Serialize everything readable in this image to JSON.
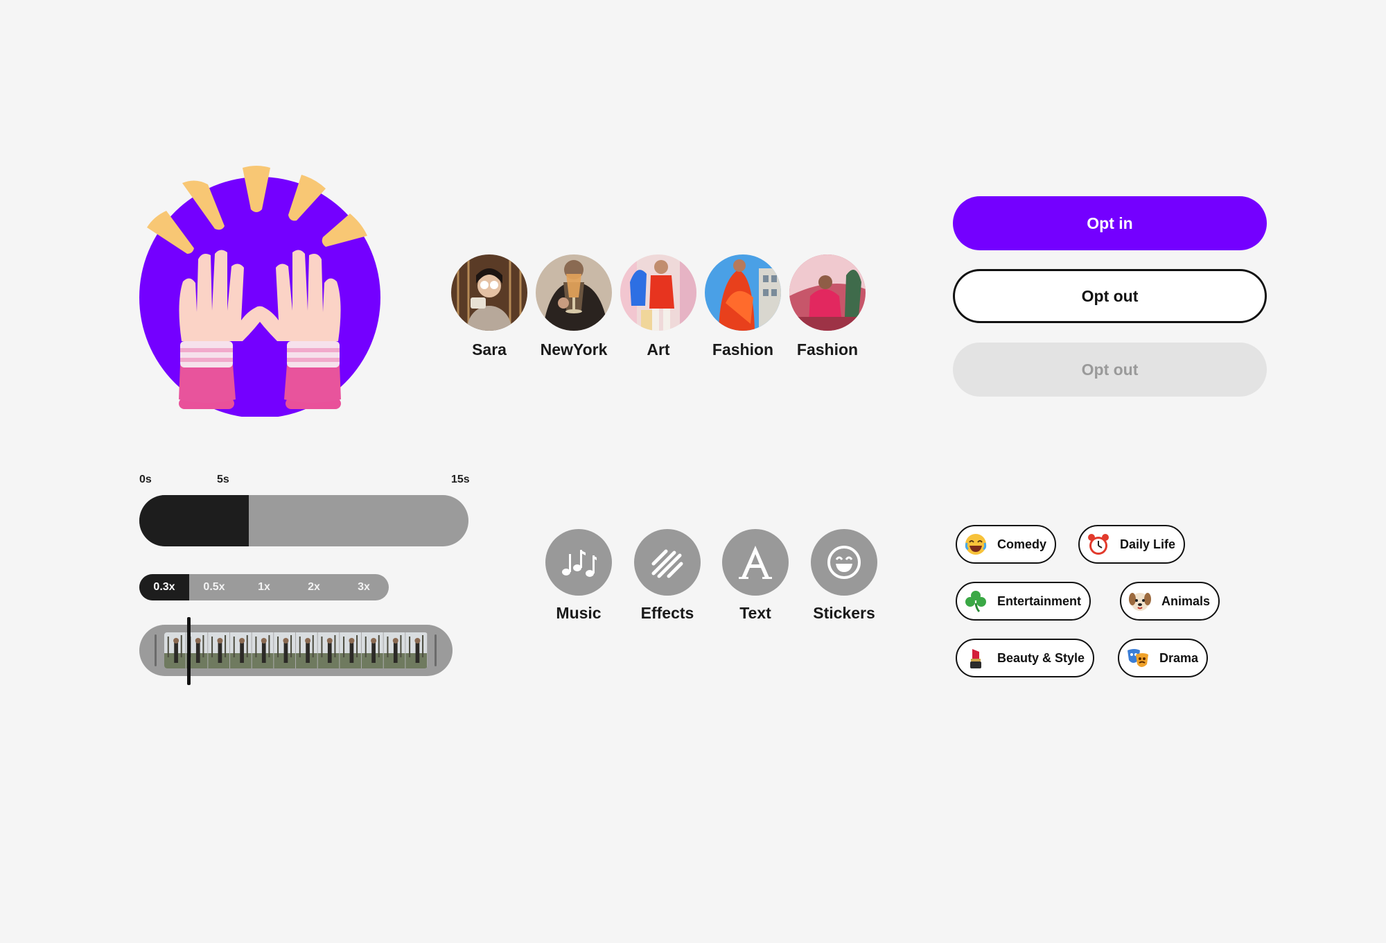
{
  "colors": {
    "accent": "#7400ff",
    "background": "#f5f5f5",
    "dark": "#1d1d1d",
    "muted": "#9b9b9b",
    "disabled": "#e3e3e3"
  },
  "hero": {
    "icon": "raised-hands-icon"
  },
  "stories": [
    {
      "label": "Sara"
    },
    {
      "label": "NewYork"
    },
    {
      "label": "Art"
    },
    {
      "label": "Fashion"
    },
    {
      "label": "Fashion"
    }
  ],
  "buttons": {
    "opt_in": "Opt in",
    "opt_out": "Opt out",
    "opt_out_disabled": "Opt out"
  },
  "timeline": {
    "ticks": [
      "0s",
      "5s",
      "15s"
    ],
    "current_seconds": 5,
    "max_seconds": 15
  },
  "speed": {
    "options": [
      "0.3x",
      "0.5x",
      "1x",
      "2x",
      "3x"
    ],
    "selected": "0.3x"
  },
  "filmstrip": {
    "frame_count": 12
  },
  "tools": [
    {
      "label": "Music",
      "icon": "music-notes-icon"
    },
    {
      "label": "Effects",
      "icon": "effects-stripes-icon"
    },
    {
      "label": "Text",
      "icon": "text-a-icon"
    },
    {
      "label": "Stickers",
      "icon": "smiley-icon"
    }
  ],
  "categories": [
    {
      "label": "Comedy",
      "icon": "laughing-face-icon"
    },
    {
      "label": "Daily Life",
      "icon": "alarm-clock-icon"
    },
    {
      "label": "Entertainment",
      "icon": "shamrock-icon"
    },
    {
      "label": "Animals",
      "icon": "dog-face-icon"
    },
    {
      "label": "Beauty & Style",
      "icon": "lipstick-icon"
    },
    {
      "label": "Drama",
      "icon": "theater-masks-icon"
    }
  ]
}
